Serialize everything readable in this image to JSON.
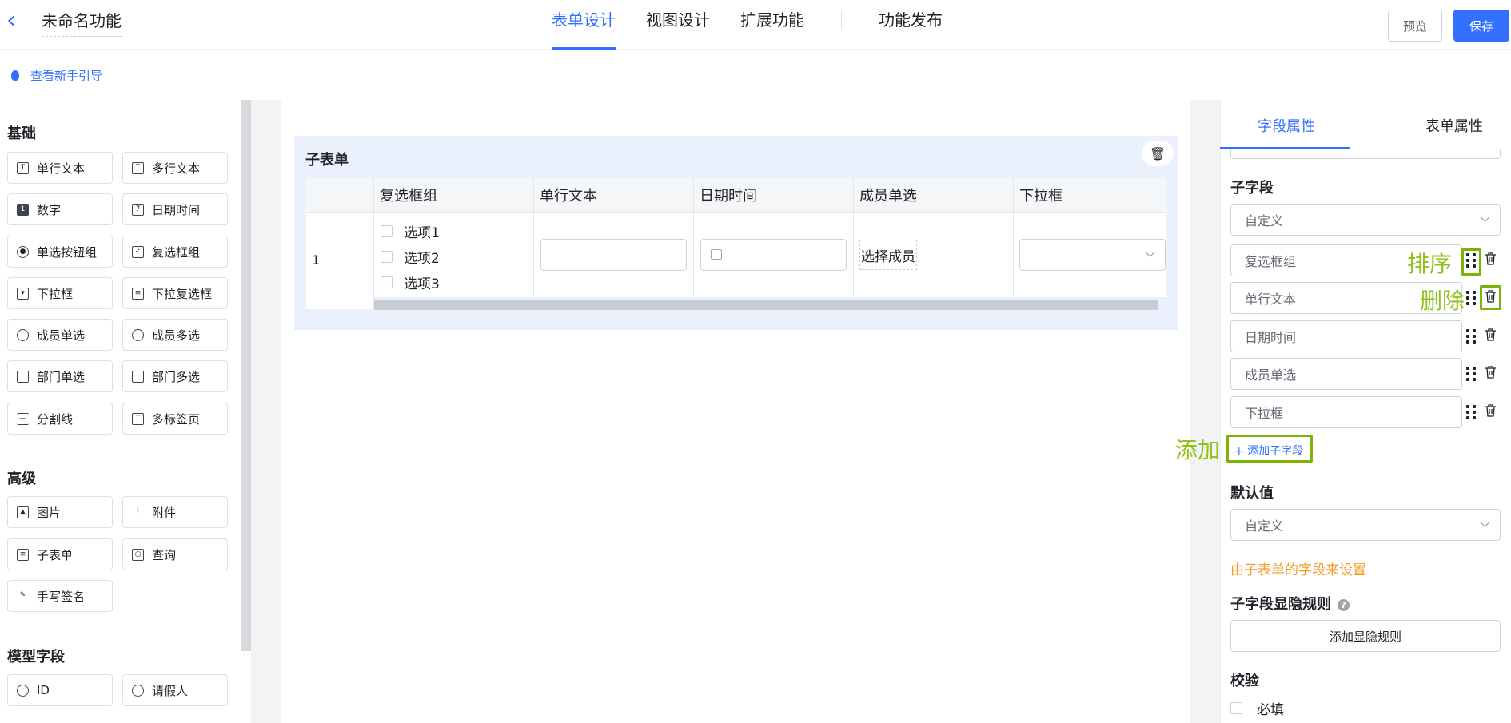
{
  "header": {
    "back_icon": "chevron-left-icon",
    "app_title": "未命名功能",
    "tabs": [
      {
        "label": "表单设计",
        "active": true
      },
      {
        "label": "视图设计",
        "active": false
      },
      {
        "label": "扩展功能",
        "active": false
      },
      {
        "label": "功能发布",
        "active": false
      }
    ]
  },
  "toolbar": {
    "guide_label": "查看新手引导",
    "preview_label": "预览",
    "save_label": "保存"
  },
  "left_panel": {
    "sections": [
      {
        "title": "基础",
        "items": [
          "单行文本",
          "多行文本",
          "数字",
          "日期时间",
          "单选按钮组",
          "复选框组",
          "下拉框",
          "下拉复选框",
          "成员单选",
          "成员多选",
          "部门单选",
          "部门多选",
          "分割线",
          "多标签页"
        ]
      },
      {
        "title": "高级",
        "items": [
          "图片",
          "附件",
          "子表单",
          "查询",
          "手写签名"
        ]
      },
      {
        "title": "模型字段",
        "items": [
          "ID",
          "请假人"
        ]
      }
    ]
  },
  "canvas": {
    "subform_title": "子表单",
    "columns": [
      "复选框组",
      "单行文本",
      "日期时间",
      "成员单选",
      "下拉框"
    ],
    "row_index": "1",
    "checkbox_options": [
      "选项1",
      "选项2",
      "选项3"
    ],
    "member_placeholder": "选择成员"
  },
  "right_panel": {
    "tabs": [
      {
        "label": "字段属性",
        "active": true
      },
      {
        "label": "表单属性",
        "active": false
      }
    ],
    "subfields_label": "子字段",
    "subfields_mode": "自定义",
    "subfields": [
      "复选框组",
      "单行文本",
      "日期时间",
      "成员单选",
      "下拉框"
    ],
    "add_subfield_label": "+ 添加子字段",
    "default_label": "默认值",
    "default_mode": "自定义",
    "default_hint": "由子表单的字段来设置",
    "visibility_label": "子字段显隐规则",
    "add_visibility_label": "添加显隐规则",
    "validation_label": "校验",
    "required_label": "必填"
  },
  "annotations": {
    "sort": "排序",
    "delete": "删除",
    "add": "添加",
    "color": "#8fc21a"
  },
  "colors": {
    "accent": "#3370ff",
    "hint": "#f59a23"
  }
}
